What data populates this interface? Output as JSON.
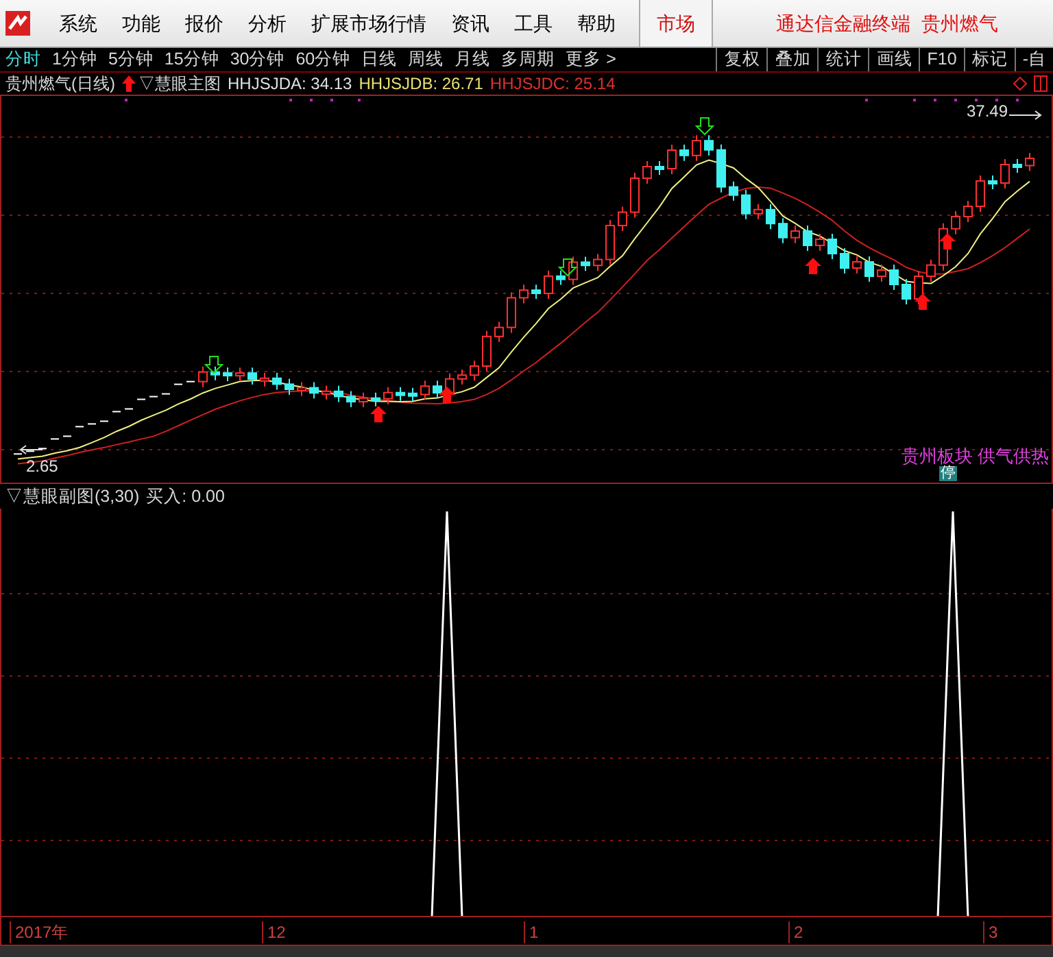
{
  "menu": {
    "items": [
      "系统",
      "功能",
      "报价",
      "分析",
      "扩展市场行情",
      "资讯",
      "工具",
      "帮助"
    ],
    "market_button": "市场",
    "title": "通达信金融终端  贵州燃气"
  },
  "period_tabs": [
    {
      "label": "分时",
      "selected": true
    },
    {
      "label": "1分钟",
      "selected": false
    },
    {
      "label": "5分钟",
      "selected": false
    },
    {
      "label": "15分钟",
      "selected": false
    },
    {
      "label": "30分钟",
      "selected": false
    },
    {
      "label": "60分钟",
      "selected": false
    },
    {
      "label": "日线",
      "selected": false
    },
    {
      "label": "周线",
      "selected": false
    },
    {
      "label": "月线",
      "selected": false
    },
    {
      "label": "多周期",
      "selected": false
    },
    {
      "label": "更多 >",
      "selected": false
    }
  ],
  "tool_buttons": [
    "复权",
    "叠加",
    "统计",
    "画线",
    "F10",
    "标记",
    "-自"
  ],
  "main_chart": {
    "stock_title": "贵州燃气(日线)",
    "indicator": "▽慧眼主图",
    "indicator_values": [
      {
        "label": "HHJSJDA: 34.13",
        "color": "#e0e0e0"
      },
      {
        "label": "HHJSJDB: 26.71",
        "color": "#e8e070"
      },
      {
        "label": "HHJSJDC: 25.14",
        "color": "#e03030"
      }
    ],
    "high_label": "37.49",
    "low_label": "2.65",
    "sector_tags": "贵州板块 供气供热",
    "stop_badge": "停"
  },
  "sub_chart": {
    "title": "▽慧眼副图(3,30)",
    "buy_label": "买入: 0.00"
  },
  "x_axis": [
    "2017年",
    "12",
    "1",
    "2",
    "3"
  ]
}
